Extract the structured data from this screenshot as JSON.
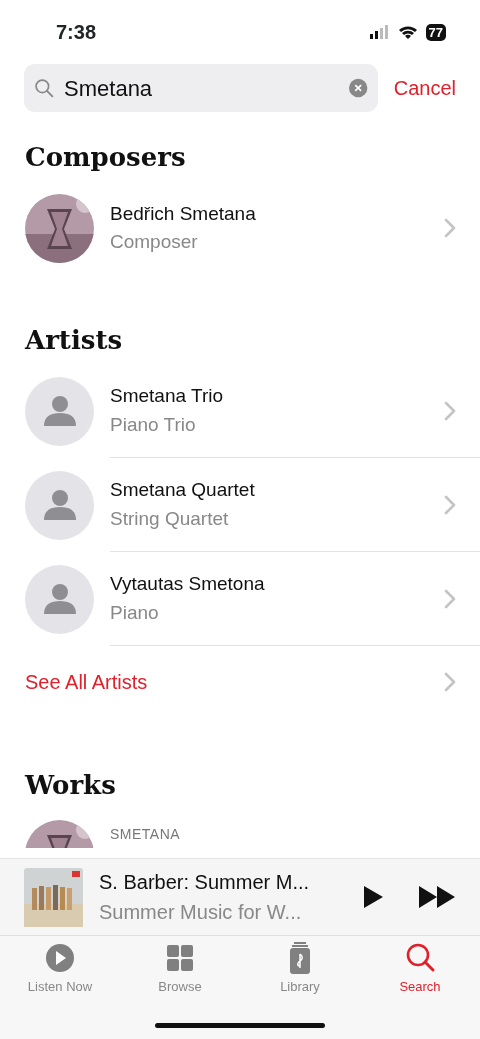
{
  "status_bar": {
    "time": "7:38",
    "battery": "77"
  },
  "search": {
    "value": "Smetana",
    "cancel": "Cancel"
  },
  "sections": [
    {
      "title": "Composers",
      "items": [
        {
          "kind": "picture",
          "title": "Bedřich Smetana",
          "subtitle": "Composer"
        }
      ]
    },
    {
      "title": "Artists",
      "items": [
        {
          "kind": "person",
          "title": "Smetana Trio",
          "subtitle": "Piano Trio"
        },
        {
          "kind": "person",
          "title": "Smetana Quartet",
          "subtitle": "String Quartet"
        },
        {
          "kind": "person",
          "title": "Vytautas Smetona",
          "subtitle": "Piano"
        }
      ],
      "see_all": "See All Artists"
    },
    {
      "title": "Works",
      "items": [
        {
          "kind": "work",
          "caption": "SMETANA"
        }
      ]
    }
  ],
  "mini_player": {
    "title": "S. Barber: Summer M...",
    "subtitle": "Summer Music for W..."
  },
  "tabs": [
    {
      "label": "Listen Now",
      "selected": false
    },
    {
      "label": "Browse",
      "selected": false
    },
    {
      "label": "Library",
      "selected": false
    },
    {
      "label": "Search",
      "selected": true
    }
  ]
}
